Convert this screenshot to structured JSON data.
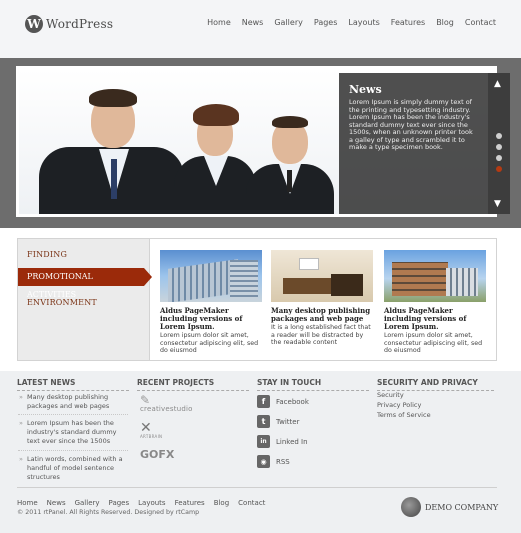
{
  "header": {
    "logo_mark": "W",
    "logo_text": "WordPress",
    "nav": [
      "Home",
      "News",
      "Gallery",
      "Pages",
      "Layouts",
      "Features",
      "Blog",
      "Contact"
    ]
  },
  "slider": {
    "news_title": "News",
    "news_text": "Lorem Ipsum is simply dummy text of the printing and typesetting industry. Lorem Ipsum has been the industry's standard dummy text ever since the 1500s, when an unknown printer took a galley of type and scrambled it to make a type specimen book.",
    "up_arrow": "▲",
    "down_arrow": "▼",
    "dots_total": 4,
    "active_dot": 4
  },
  "menu": {
    "items": [
      "FINDING",
      "PROMOTIONAL ACTIVITIES",
      "ENVIRONMENT"
    ],
    "active_index": 1
  },
  "cards": [
    {
      "title": "Aldus PageMaker including versions of Lorem Ipsum.",
      "text": "Lorem ipsum dolor sit amet, consectetur adipiscing elit, sed do eiusmod"
    },
    {
      "title": "Many desktop publishing packages and web page",
      "text": "It is a long established fact that a reader will be distracted by the readable content"
    },
    {
      "title": "Aldus PageMaker including versions of Lorem Ipsum.",
      "text": "Lorem ipsum dolor sit amet, consectetur adipiscing elit, sed do eiusmod"
    }
  ],
  "footer": {
    "latest_news": {
      "heading": "LATEST NEWS",
      "items": [
        "Many desktop publishing packages and web pages",
        "Lorem Ipsum has been the industry's standard dummy text ever since the 1500s",
        "Latin words, combined with a handful of model sentence structures"
      ]
    },
    "recent_projects": {
      "heading": "RECENT PROJECTS",
      "logos": [
        "creativestudio",
        "ARTBRAIN",
        "GOFX"
      ]
    },
    "stay_in_touch": {
      "heading": "STAY IN TOUCH",
      "items": [
        {
          "icon": "facebook-icon",
          "glyph": "f",
          "label": "Facebook"
        },
        {
          "icon": "twitter-icon",
          "glyph": "t",
          "label": "Twitter"
        },
        {
          "icon": "linkedin-icon",
          "glyph": "in",
          "label": "Linked In"
        },
        {
          "icon": "rss-icon",
          "glyph": "◉",
          "label": "RSS"
        }
      ]
    },
    "security": {
      "heading": "SECURITY AND PRIVACY",
      "links": [
        "Security",
        "Privacy Policy",
        "Terms of Service"
      ]
    },
    "bottom_nav": [
      "Home",
      "News",
      "Gallery",
      "Pages",
      "Layouts",
      "Features",
      "Blog",
      "Contact"
    ],
    "copyright": "© 2011 rtPanel. All Rights Reserved. Designed by rtCamp",
    "company": "DEMO COMPANY"
  },
  "colors": {
    "accent": "#9b2a0a",
    "band": "#6d6d6d",
    "panel": "#282828"
  }
}
